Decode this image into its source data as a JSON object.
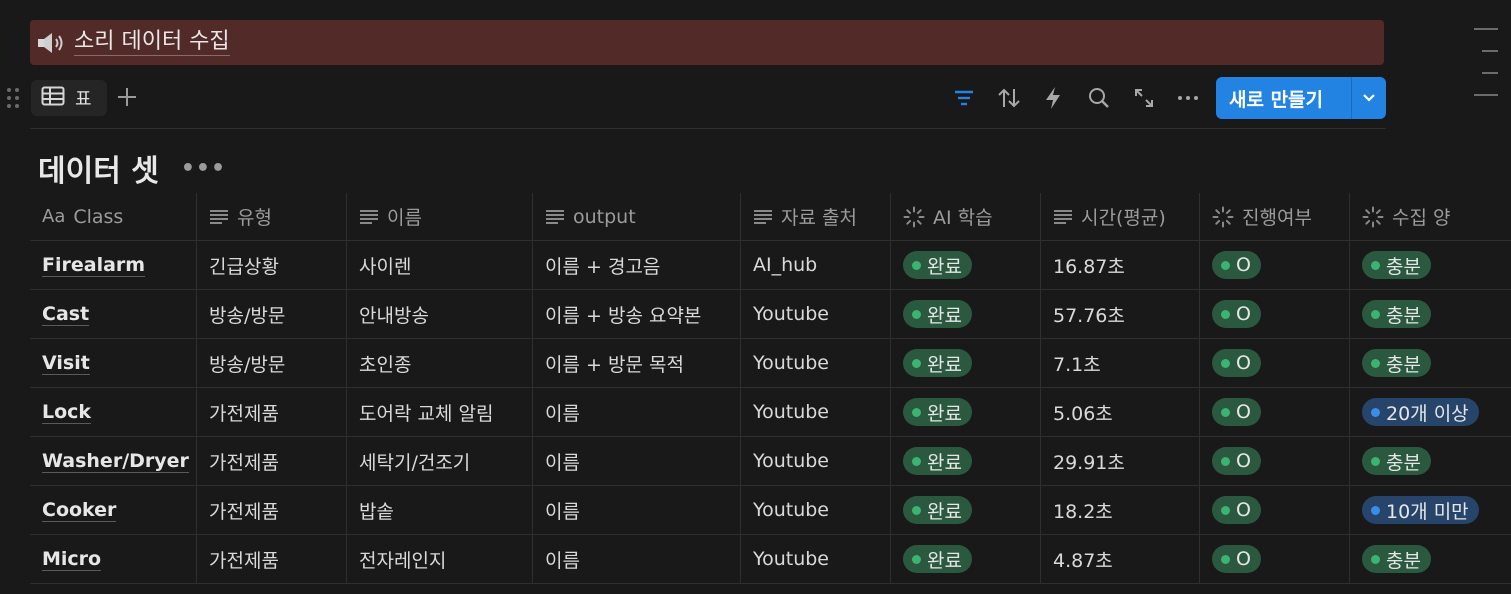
{
  "page": {
    "banner_title": "소리 데이터 수집",
    "banner_icon": "speaker-icon"
  },
  "toolbar": {
    "view_label": "표",
    "new_button_label": "새로 만들기",
    "accent_color": "#2383e2"
  },
  "database": {
    "title": "데이터 셋",
    "more_label": "•••",
    "columns": [
      {
        "label": "Class",
        "icon": "Aa"
      },
      {
        "label": "유형",
        "icon": "text-icon"
      },
      {
        "label": "이름",
        "icon": "text-icon"
      },
      {
        "label": "output",
        "icon": "text-icon"
      },
      {
        "label": "자료 출처",
        "icon": "text-icon"
      },
      {
        "label": "AI 학습",
        "icon": "status-icon"
      },
      {
        "label": "시간(평균)",
        "icon": "text-icon"
      },
      {
        "label": "진행여부",
        "icon": "status-icon"
      },
      {
        "label": "수집 양",
        "icon": "status-icon"
      }
    ],
    "rows": [
      {
        "class": "Firealarm",
        "type": "긴급상황",
        "name": "사이렌",
        "output": "이름 + 경고음",
        "source": "AI_hub",
        "ai": "완료",
        "time": "16.87초",
        "progress": "O",
        "amount": "충분",
        "amount_color": "green"
      },
      {
        "class": "Cast",
        "type": "방송/방문",
        "name": "안내방송",
        "output": "이름 + 방송 요약본",
        "source": "Youtube",
        "ai": "완료",
        "time": "57.76초",
        "progress": "O",
        "amount": "충분",
        "amount_color": "green"
      },
      {
        "class": "Visit",
        "type": "방송/방문",
        "name": "초인종",
        "output": "이름 + 방문 목적",
        "source": "Youtube",
        "ai": "완료",
        "time": "7.1초",
        "progress": "O",
        "amount": "충분",
        "amount_color": "green"
      },
      {
        "class": "Lock",
        "type": "가전제품",
        "name": "도어락 교체 알림",
        "output": "이름",
        "source": "Youtube",
        "ai": "완료",
        "time": "5.06초",
        "progress": "O",
        "amount": "20개 이상",
        "amount_color": "blue"
      },
      {
        "class": "Washer/Dryer",
        "type": "가전제품",
        "name": "세탁기/건조기",
        "output": "이름",
        "source": "Youtube",
        "ai": "완료",
        "time": "29.91초",
        "progress": "O",
        "amount": "충분",
        "amount_color": "green"
      },
      {
        "class": "Cooker",
        "type": "가전제품",
        "name": "밥솥",
        "output": "이름",
        "source": "Youtube",
        "ai": "완료",
        "time": "18.2초",
        "progress": "O",
        "amount": "10개 미만",
        "amount_color": "blue"
      },
      {
        "class": "Micro",
        "type": "가전제품",
        "name": "전자레인지",
        "output": "이름",
        "source": "Youtube",
        "ai": "완료",
        "time": "4.87초",
        "progress": "O",
        "amount": "충분",
        "amount_color": "green"
      }
    ]
  }
}
